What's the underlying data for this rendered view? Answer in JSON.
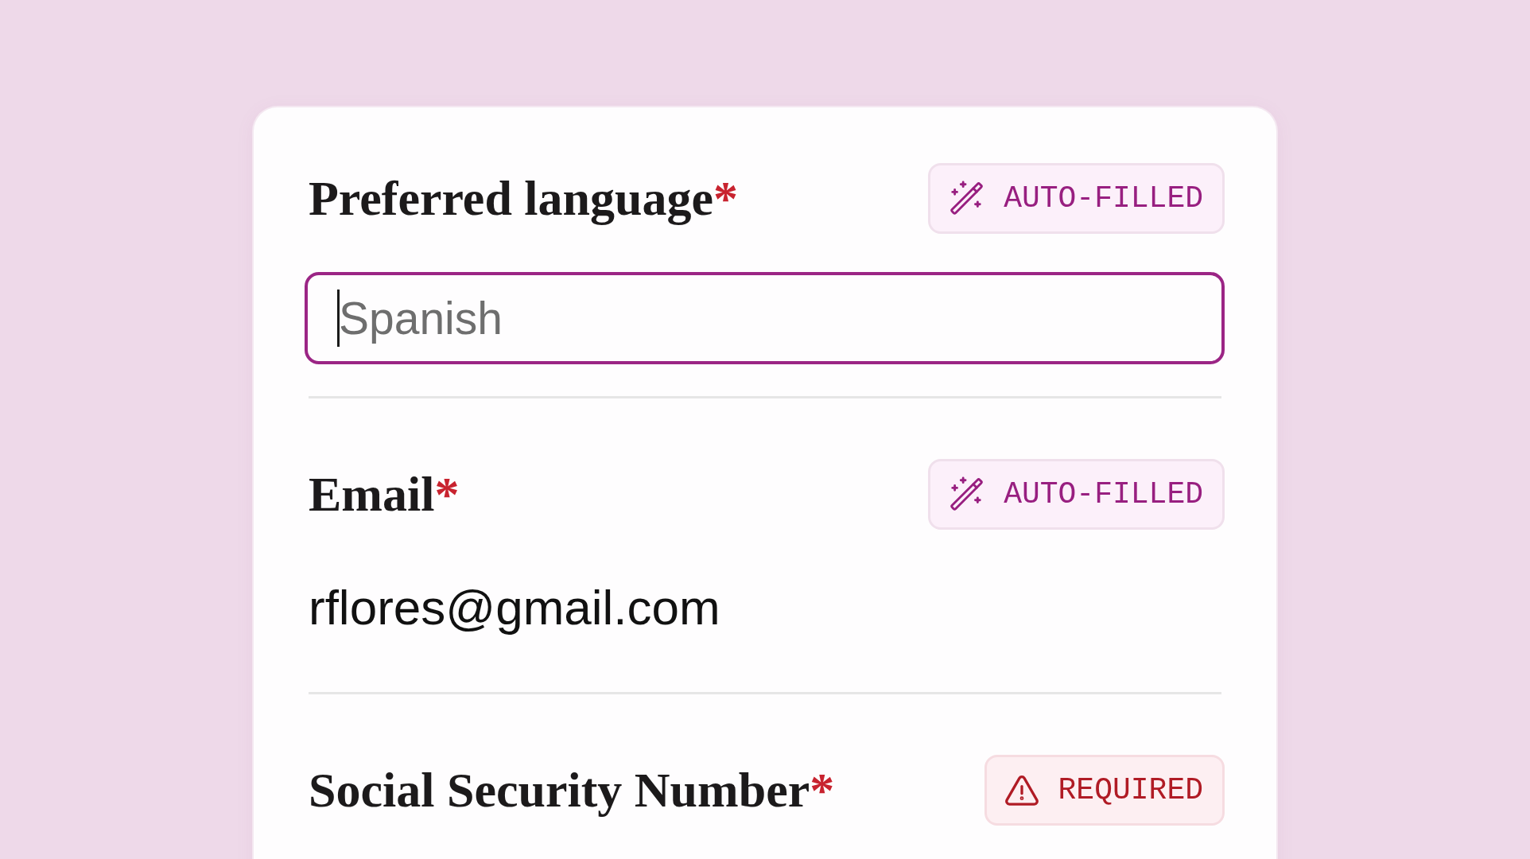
{
  "form": {
    "fields": [
      {
        "label": "Preferred language",
        "required_mark": "*",
        "badge": {
          "kind": "autofilled",
          "text": "AUTO-FILLED"
        },
        "control": {
          "kind": "input",
          "placeholder": "Spanish",
          "focused": true
        }
      },
      {
        "label": "Email",
        "required_mark": "*",
        "badge": {
          "kind": "autofilled",
          "text": "AUTO-FILLED"
        },
        "control": {
          "kind": "text",
          "value": "rflores@gmail.com"
        }
      },
      {
        "label": "Social Security Number",
        "required_mark": "*",
        "badge": {
          "kind": "required",
          "text": "REQUIRED"
        }
      }
    ]
  }
}
